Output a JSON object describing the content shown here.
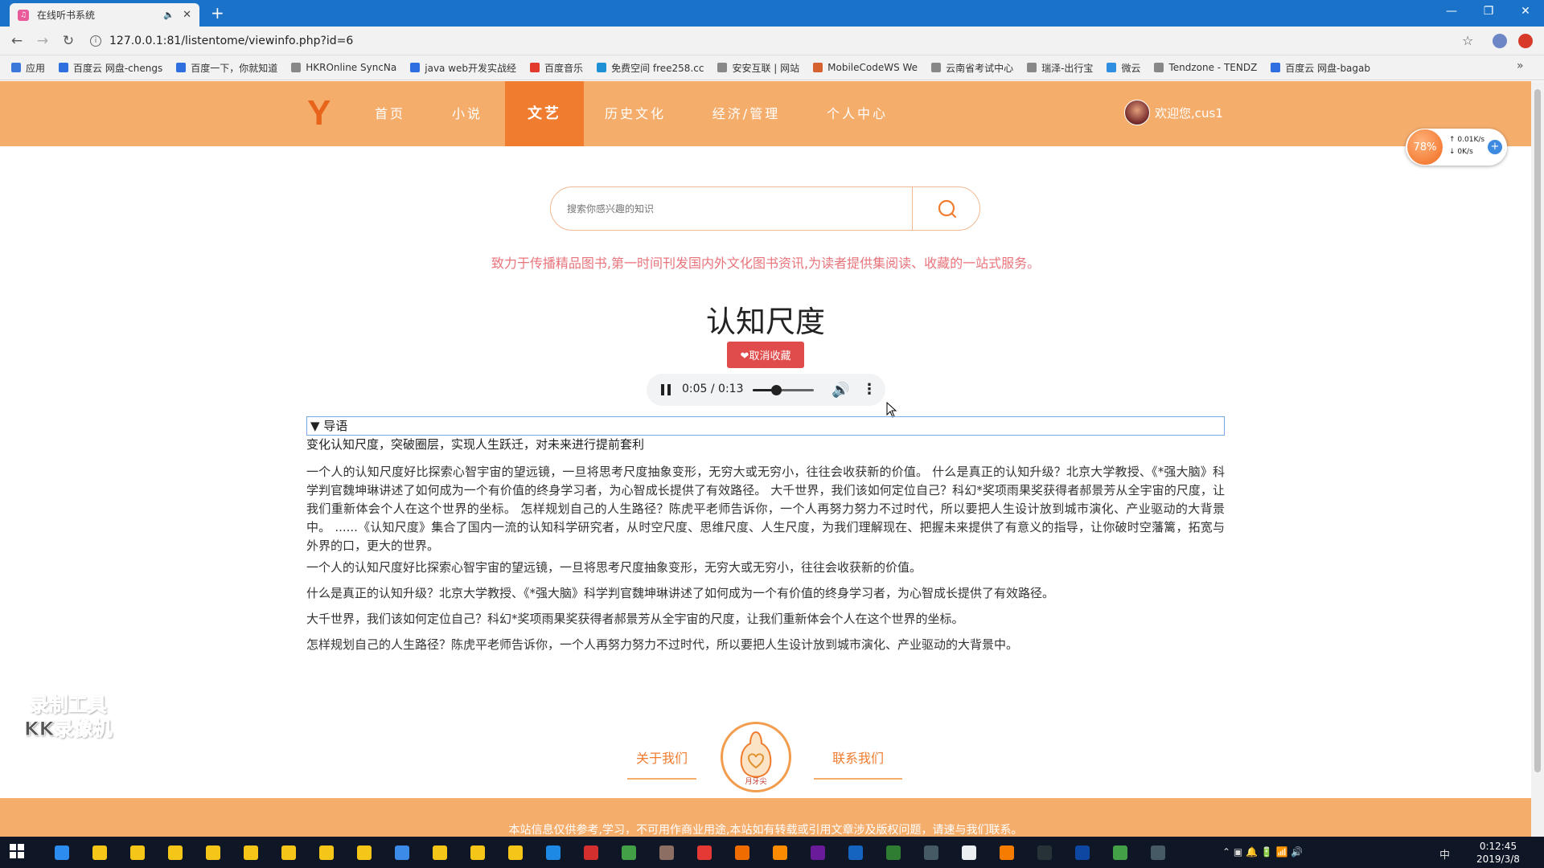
{
  "browser": {
    "tab_title": "在线听书系统",
    "new_tab": "+",
    "url": "127.0.0.1:81/listentome/viewinfo.php?id=6",
    "bookmarks": [
      {
        "label": "应用",
        "color": "#3c78d8"
      },
      {
        "label": "百度云 网盘-chengs",
        "color": "#2f6fe0"
      },
      {
        "label": "百度一下，你就知道",
        "color": "#2f6fe0"
      },
      {
        "label": "HKROnline SyncNa",
        "color": "#888"
      },
      {
        "label": "java web开发实战经",
        "color": "#2f6fe0"
      },
      {
        "label": "百度音乐",
        "color": "#e23b2e"
      },
      {
        "label": "免费空间 free258.cc",
        "color": "#1e90d6"
      },
      {
        "label": "安安互联 | 网站",
        "color": "#888"
      },
      {
        "label": "MobileCodeWS We",
        "color": "#d6622f"
      },
      {
        "label": "云南省考试中心",
        "color": "#888"
      },
      {
        "label": "瑞泽-出行宝",
        "color": "#888"
      },
      {
        "label": "微云",
        "color": "#2f8ee0"
      },
      {
        "label": "Tendzone - TENDZ",
        "color": "#888"
      },
      {
        "label": "百度云 网盘-bagab",
        "color": "#2f6fe0"
      }
    ],
    "bookmarks_more": "»"
  },
  "site": {
    "logo": "Y",
    "nav": [
      "首页",
      "小说",
      "文艺",
      "历史文化",
      "经济/管理",
      "个人中心"
    ],
    "active_nav": "文艺",
    "welcome": "欢迎您,cus1",
    "search_placeholder": "搜索你感兴趣的知识",
    "slogan": "致力于传播精品图书,第一时间刊发国内外文化图书资讯,为读者提供集阅读、收藏的一站式服务。"
  },
  "speed_widget": {
    "percent": "78%",
    "up": "0.01K/s",
    "down": "0K/s"
  },
  "book": {
    "title": "认知尺度",
    "favorite_button": "❤取消收藏",
    "audio": {
      "time": "0:05 / 0:13",
      "progress": 0.38
    },
    "intro_label": "▼ 导语",
    "subtitle": "变化认知尺度，突破圈层，实现人生跃迁，对未来进行提前套利",
    "paragraph": "一个人的认知尺度好比探索心智宇宙的望远镜，一旦将思考尺度抽象变形，无穷大或无穷小，往往会收获新的价值。 什么是真正的认知升级？北京大学教授、《*强大脑》科学判官魏坤琳讲述了如何成为一个有价值的终身学习者，为心智成长提供了有效路径。 大千世界，我们该如何定位自己？科幻*奖项雨果奖获得者郝景芳从全宇宙的尺度，让我们重新体会个人在这个世界的坐标。 怎样规划自己的人生路径？陈虎平老师告诉你，一个人再努力努力不过时代，所以要把人生设计放到城市演化、产业驱动的大背景中。 ......《认知尺度》集合了国内一流的认知科学研究者，从时空尺度、思维尺度、人生尺度，为我们理解现在、把握未来提供了有意义的指导，让你破时空藩篱，拓宽与外界的口，更大的世界。",
    "lines": [
      "一个人的认知尺度好比探索心智宇宙的望远镜，一旦将思考尺度抽象变形，无穷大或无穷小，往往会收获新的价值。",
      "什么是真正的认知升级？北京大学教授、《*强大脑》科学判官魏坤琳讲述了如何成为一个有价值的终身学习者，为心智成长提供了有效路径。",
      "大千世界，我们该如何定位自己？科幻*奖项雨果奖获得者郝景芳从全宇宙的尺度，让我们重新体会个人在这个世界的坐标。",
      "怎样规划自己的人生路径？陈虎平老师告诉你，一个人再努力努力不过时代，所以要把人生设计放到城市演化、产业驱动的大背景中。"
    ]
  },
  "watermark": {
    "line1": "录制工具",
    "line2": "KK录像机"
  },
  "footer": {
    "about": "关于我们",
    "contact": "联系我们",
    "logo_text": "月牙尖",
    "note": "本站信息仅供参考,学习，不可用作商业用途,本站如有转载或引用文章涉及版权问题，请速与我们联系。"
  },
  "taskbar": {
    "time": "0:12:45",
    "date": "2019/3/8",
    "ime": "中"
  }
}
